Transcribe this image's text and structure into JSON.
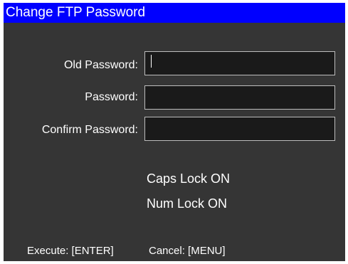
{
  "window": {
    "title": "Change FTP Password"
  },
  "form": {
    "old_password": {
      "label": "Old Password:",
      "value": ""
    },
    "password": {
      "label": "Password:",
      "value": ""
    },
    "confirm_password": {
      "label": "Confirm Password:",
      "value": ""
    }
  },
  "status": {
    "caps_lock": "Caps Lock ON",
    "num_lock": "Num Lock ON"
  },
  "footer": {
    "execute": "Execute: [ENTER]",
    "cancel": "Cancel: [MENU]"
  },
  "colors": {
    "title_bar": "#0000ff",
    "background": "#353535",
    "field_background": "#1a1a1a",
    "field_border": "#bdbdbd",
    "text": "#ffffff"
  }
}
